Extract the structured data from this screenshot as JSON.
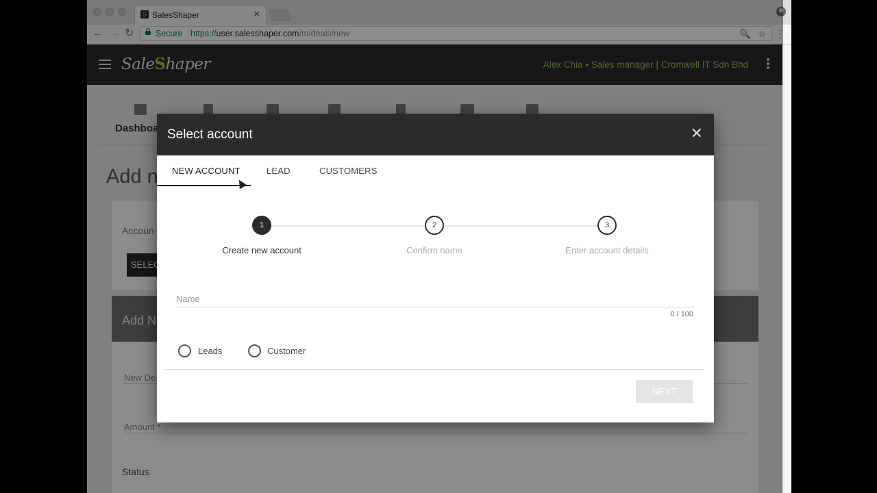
{
  "browser": {
    "tab_title": "SalesShaper",
    "tab_close": "×",
    "secure_label": "Secure",
    "url_scheme": "https://",
    "url_host": "user.salesshaper.com",
    "url_path": "/m/deals/new",
    "back": "←",
    "forward": "→",
    "reload": "↻",
    "zoom_icon": "🔍",
    "star_icon": "☆",
    "menu": "⋮"
  },
  "app": {
    "logo_left": "Sale",
    "logo_mark": "S",
    "logo_right": "haper",
    "user_name": "Alex Chia",
    "bullet": "•",
    "user_role": "Sales manager",
    "pipe": "|",
    "company": "Cromwell IT Sdn Bhd"
  },
  "page": {
    "nav_first_label": "Dashboa",
    "title": "Add n",
    "account_label": "Accoun",
    "select_button": "SELEC",
    "card_title": "Add N",
    "new_deal_label": "New De",
    "amount_label": "Amount *",
    "status_label": "Status"
  },
  "dialog": {
    "title": "Select account",
    "close": "✕",
    "tabs": [
      "NEW ACCOUNT",
      "LEAD",
      "CUSTOMERS"
    ],
    "steps": [
      {
        "num": "1",
        "label": "Create new account"
      },
      {
        "num": "2",
        "label": "Confirm name"
      },
      {
        "num": "3",
        "label": "Enter account details"
      }
    ],
    "name_placeholder": "Name",
    "name_value": "",
    "counter": "0 / 100",
    "radios": [
      "Leads",
      "Customer"
    ],
    "next": "NEXT"
  }
}
